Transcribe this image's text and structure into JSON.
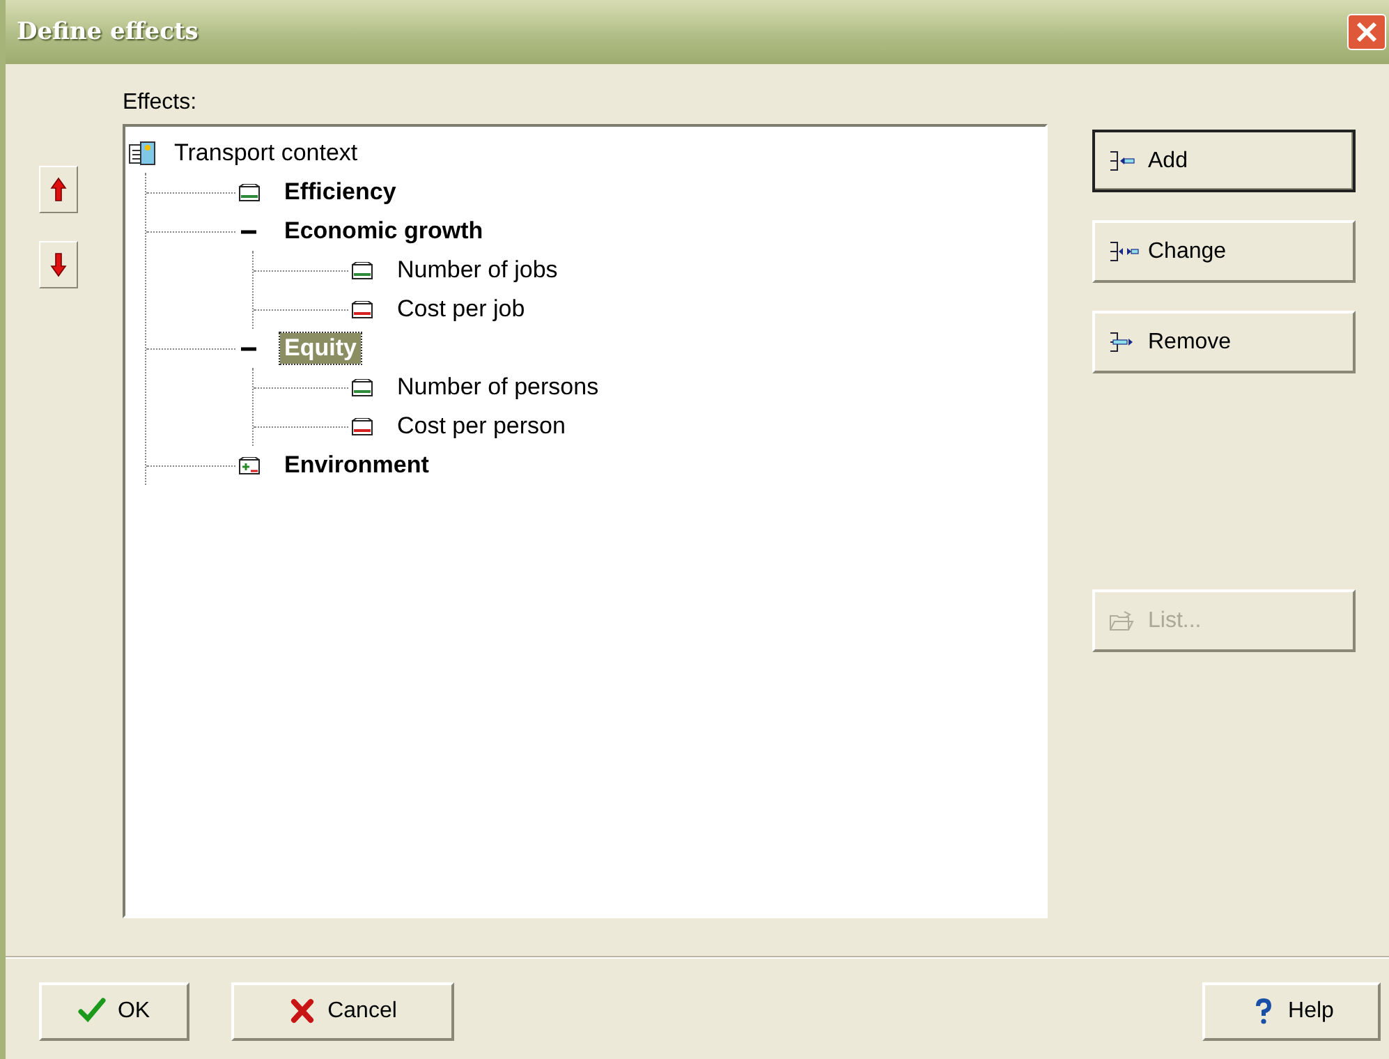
{
  "window": {
    "title": "Define effects"
  },
  "effects_label": "Effects:",
  "tree": {
    "label": "Transport context",
    "selected": false,
    "children": [
      {
        "label": "Efficiency",
        "selected": false,
        "color": "#2e8b3a"
      },
      {
        "label": "Economic growth",
        "selected": false,
        "expanded": true,
        "children": [
          {
            "label": "Number of jobs",
            "selected": false,
            "color": "#2e8b3a"
          },
          {
            "label": "Cost per job",
            "selected": false,
            "color": "#d42020"
          }
        ]
      },
      {
        "label": "Equity",
        "selected": true,
        "expanded": true,
        "children": [
          {
            "label": "Number of persons",
            "selected": false,
            "color": "#2e8b3a"
          },
          {
            "label": "Cost per person",
            "selected": false,
            "color": "#d42020"
          }
        ]
      },
      {
        "label": "Environment",
        "selected": false,
        "expanded": false
      }
    ]
  },
  "side_buttons": [
    {
      "kind": "add",
      "label": "Add",
      "default": true,
      "disabled": false
    },
    {
      "kind": "change",
      "label": "Change",
      "default": false,
      "disabled": false
    },
    {
      "kind": "remove",
      "label": "Remove",
      "default": false,
      "disabled": false
    },
    {
      "kind": "list",
      "label": "List...",
      "default": false,
      "disabled": true
    }
  ],
  "footer_buttons": [
    {
      "kind": "ok",
      "label": "OK"
    },
    {
      "kind": "cancel",
      "label": "Cancel"
    },
    {
      "kind": "help",
      "label": "Help"
    }
  ]
}
